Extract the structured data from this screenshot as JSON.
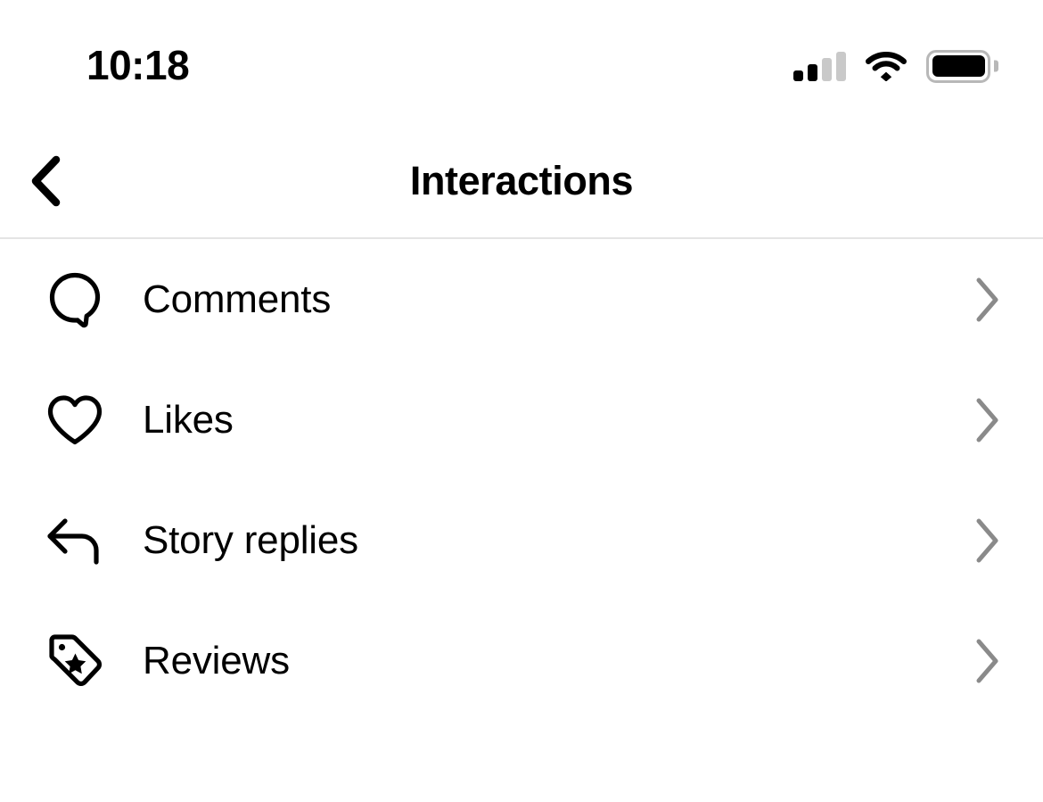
{
  "status_bar": {
    "time": "10:18",
    "signal_icon": "cellular-signal-icon",
    "signal_bars_filled": 2,
    "signal_bars_total": 4,
    "wifi_icon": "wifi-icon",
    "battery_icon": "battery-icon",
    "battery_level_percent": 95
  },
  "header": {
    "back_icon": "chevron-left-icon",
    "title": "Interactions"
  },
  "list": {
    "items": [
      {
        "label": "Comments",
        "icon": "comment-bubble-icon",
        "chevron": "chevron-right-icon"
      },
      {
        "label": "Likes",
        "icon": "heart-icon",
        "chevron": "chevron-right-icon"
      },
      {
        "label": "Story replies",
        "icon": "reply-arrow-icon",
        "chevron": "chevron-right-icon"
      },
      {
        "label": "Reviews",
        "icon": "tag-star-icon",
        "chevron": "chevron-right-icon"
      }
    ]
  },
  "colors": {
    "background": "#ffffff",
    "text_primary": "#000000",
    "chevron_gray": "#8a8a8a",
    "divider": "#e4e4e4",
    "status_inactive": "#c9c9c9",
    "battery_outline": "#b8b8b8"
  }
}
